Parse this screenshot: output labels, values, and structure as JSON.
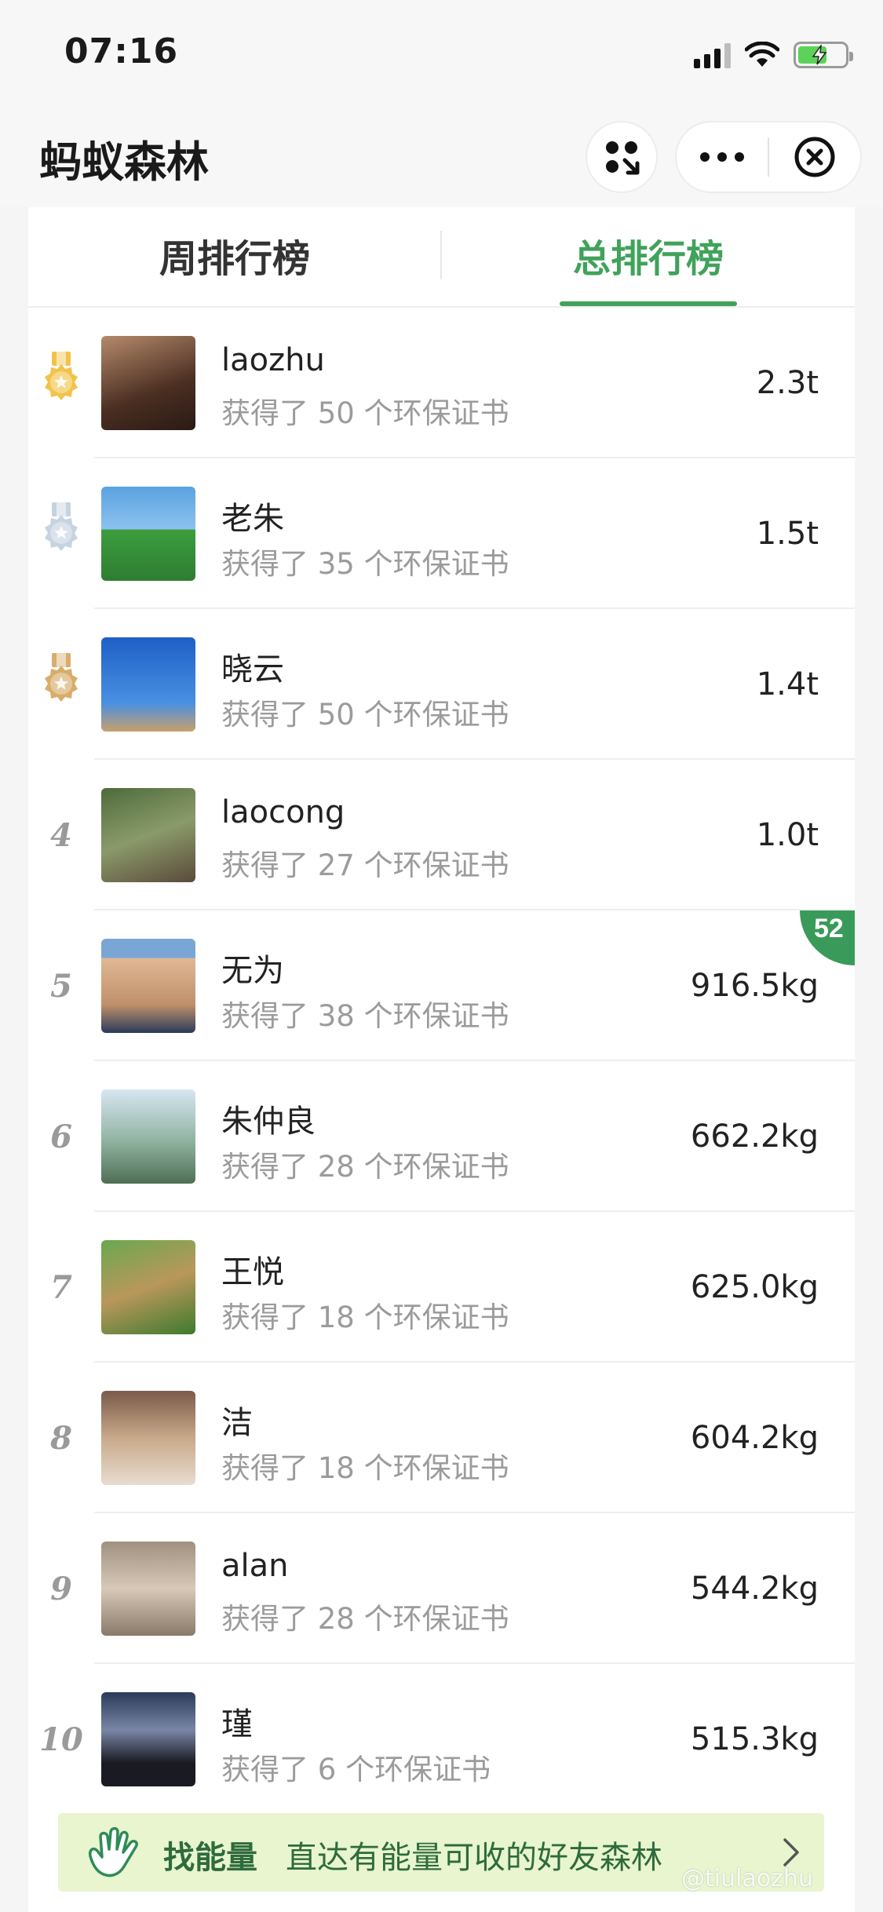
{
  "status_bar": {
    "time": "07:16"
  },
  "navbar": {
    "title": "蚂蚁森林",
    "icons": [
      "more-icon",
      "close-icon",
      "applet-icon"
    ]
  },
  "tabs": {
    "week": "周排行榜",
    "total": "总排行榜",
    "active": "total"
  },
  "ranking": [
    {
      "rank": "1",
      "name": "laozhu",
      "sub": "获得了 50 个环保证书",
      "amount": "2.3t"
    },
    {
      "rank": "2",
      "name": "老朱",
      "sub": "获得了 35 个环保证书",
      "amount": "1.5t"
    },
    {
      "rank": "3",
      "name": "晓云",
      "sub": "获得了 50 个环保证书",
      "amount": "1.4t"
    },
    {
      "rank": "4",
      "name": "laocong",
      "sub": "获得了 27 个环保证书",
      "amount": "1.0t"
    },
    {
      "rank": "5",
      "name": "无为",
      "sub": "获得了 38 个环保证书",
      "amount": "916.5kg"
    },
    {
      "rank": "6",
      "name": "朱仲良",
      "sub": "获得了 28 个环保证书",
      "amount": "662.2kg"
    },
    {
      "rank": "7",
      "name": "王悦",
      "sub": "获得了 18 个环保证书",
      "amount": "625.0kg"
    },
    {
      "rank": "8",
      "name": "洁",
      "sub": "获得了 18 个环保证书",
      "amount": "604.2kg"
    },
    {
      "rank": "9",
      "name": "alan",
      "sub": "获得了 28 个环保证书",
      "amount": "544.2kg"
    },
    {
      "rank": "10",
      "name": "瑾",
      "sub": "获得了 6 个环保证书",
      "amount": "515.3kg"
    }
  ],
  "corner_badge": "52",
  "banner": {
    "title": "找能量",
    "text": "直达有能量可收的好友森林"
  },
  "watermark": "@tiulaozhu",
  "colors": {
    "accent": "#41a25b",
    "gold": "#f2c34a",
    "silver": "#c6d3e0",
    "bronze": "#d8ad6a",
    "banner_bg": "#e8f5cf"
  }
}
